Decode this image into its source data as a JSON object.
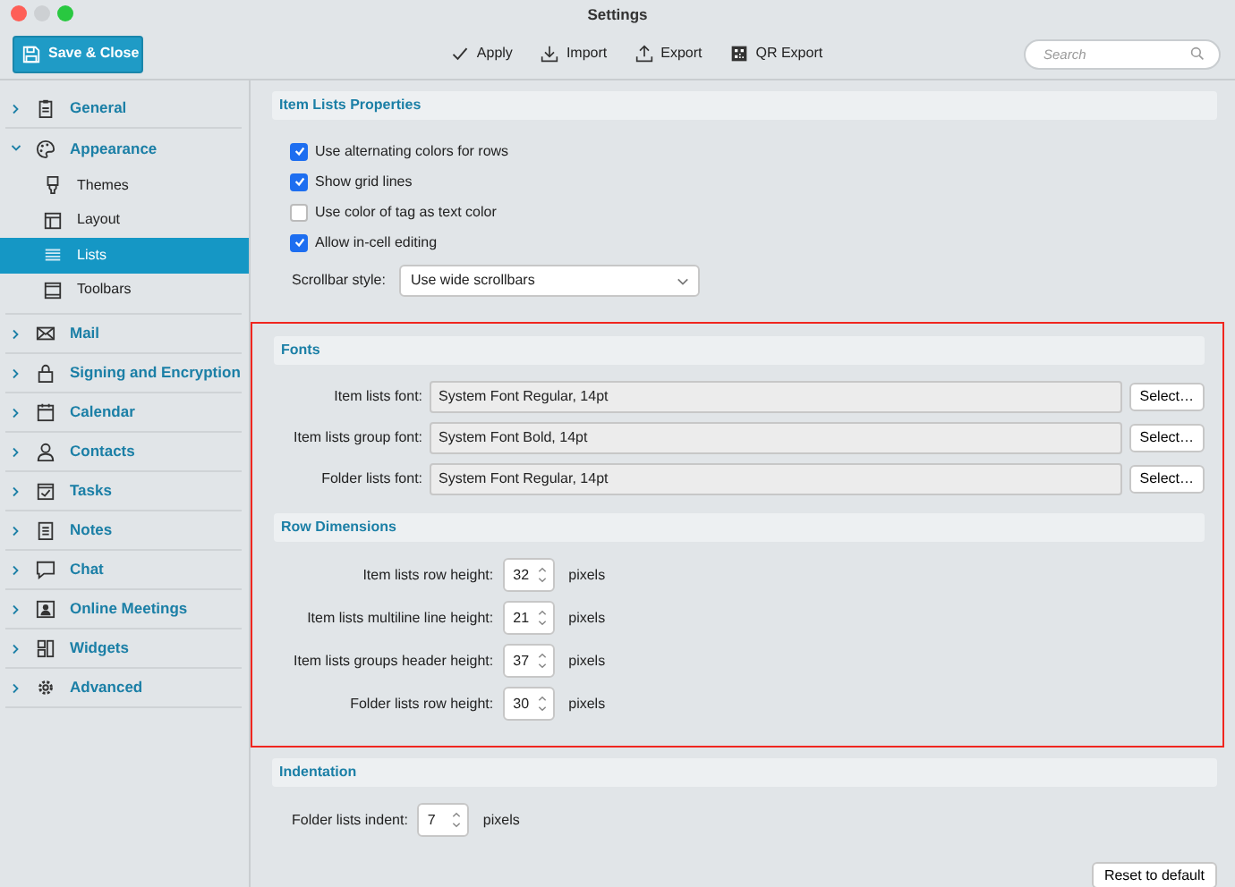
{
  "window": {
    "title": "Settings"
  },
  "toolbar": {
    "save_button": "Save & Close",
    "actions": [
      {
        "label": "Apply"
      },
      {
        "label": "Import"
      },
      {
        "label": "Export"
      },
      {
        "label": "QR Export"
      }
    ],
    "search": {
      "placeholder": "Search"
    }
  },
  "sidebar": {
    "items": [
      {
        "label": "General",
        "expanded": false,
        "selected": false
      },
      {
        "label": "Appearance",
        "expanded": true,
        "selected": false,
        "children": [
          {
            "label": "Themes",
            "selected": false
          },
          {
            "label": "Layout",
            "selected": false
          },
          {
            "label": "Lists",
            "selected": true
          },
          {
            "label": "Toolbars",
            "selected": false
          }
        ]
      },
      {
        "label": "Mail",
        "expanded": false,
        "selected": false
      },
      {
        "label": "Signing and Encryption",
        "expanded": false,
        "selected": false
      },
      {
        "label": "Calendar",
        "expanded": false,
        "selected": false
      },
      {
        "label": "Contacts",
        "expanded": false,
        "selected": false
      },
      {
        "label": "Tasks",
        "expanded": false,
        "selected": false
      },
      {
        "label": "Notes",
        "expanded": false,
        "selected": false
      },
      {
        "label": "Chat",
        "expanded": false,
        "selected": false
      },
      {
        "label": "Online Meetings",
        "expanded": false,
        "selected": false
      },
      {
        "label": "Widgets",
        "expanded": false,
        "selected": false
      },
      {
        "label": "Advanced",
        "expanded": false,
        "selected": false
      }
    ]
  },
  "sections": [
    {
      "title": "Item Lists Properties",
      "highlighted": false,
      "rows": [
        {
          "kind": "checkbox",
          "label": "Use alternating colors for rows",
          "checked": true
        },
        {
          "kind": "checkbox",
          "label": "Show grid lines",
          "checked": true
        },
        {
          "kind": "checkbox",
          "label": "Use color of tag as text color",
          "checked": false
        },
        {
          "kind": "checkbox",
          "label": "Allow in-cell editing",
          "checked": true
        },
        {
          "kind": "select",
          "label": "Scrollbar style:",
          "value": "Use wide scrollbars"
        }
      ]
    },
    {
      "title": "Fonts",
      "highlighted": true,
      "rows": [
        {
          "kind": "font",
          "label": "Item lists font:",
          "value": "System Font Regular, 14pt",
          "button": "Select…"
        },
        {
          "kind": "font",
          "label": "Item lists group font:",
          "value": "System Font Bold, 14pt",
          "button": "Select…"
        },
        {
          "kind": "font",
          "label": "Folder lists font:",
          "value": "System Font Regular, 14pt",
          "button": "Select…"
        }
      ]
    },
    {
      "title": "Row Dimensions",
      "highlighted": true,
      "rows": [
        {
          "kind": "number",
          "label": "Item lists row height:",
          "value": "32",
          "unit": "pixels"
        },
        {
          "kind": "number",
          "label": "Item lists multiline line height:",
          "value": "21",
          "unit": "pixels"
        },
        {
          "kind": "number",
          "label": "Item lists groups header height:",
          "value": "37",
          "unit": "pixels"
        },
        {
          "kind": "number",
          "label": "Folder lists row height:",
          "value": "30",
          "unit": "pixels"
        }
      ]
    },
    {
      "title": "Indentation",
      "highlighted": false,
      "rows": [
        {
          "kind": "number",
          "label": "Folder lists indent:",
          "value": "7",
          "unit": "pixels"
        }
      ]
    }
  ],
  "footer": {
    "reset_button": "Reset to default"
  }
}
